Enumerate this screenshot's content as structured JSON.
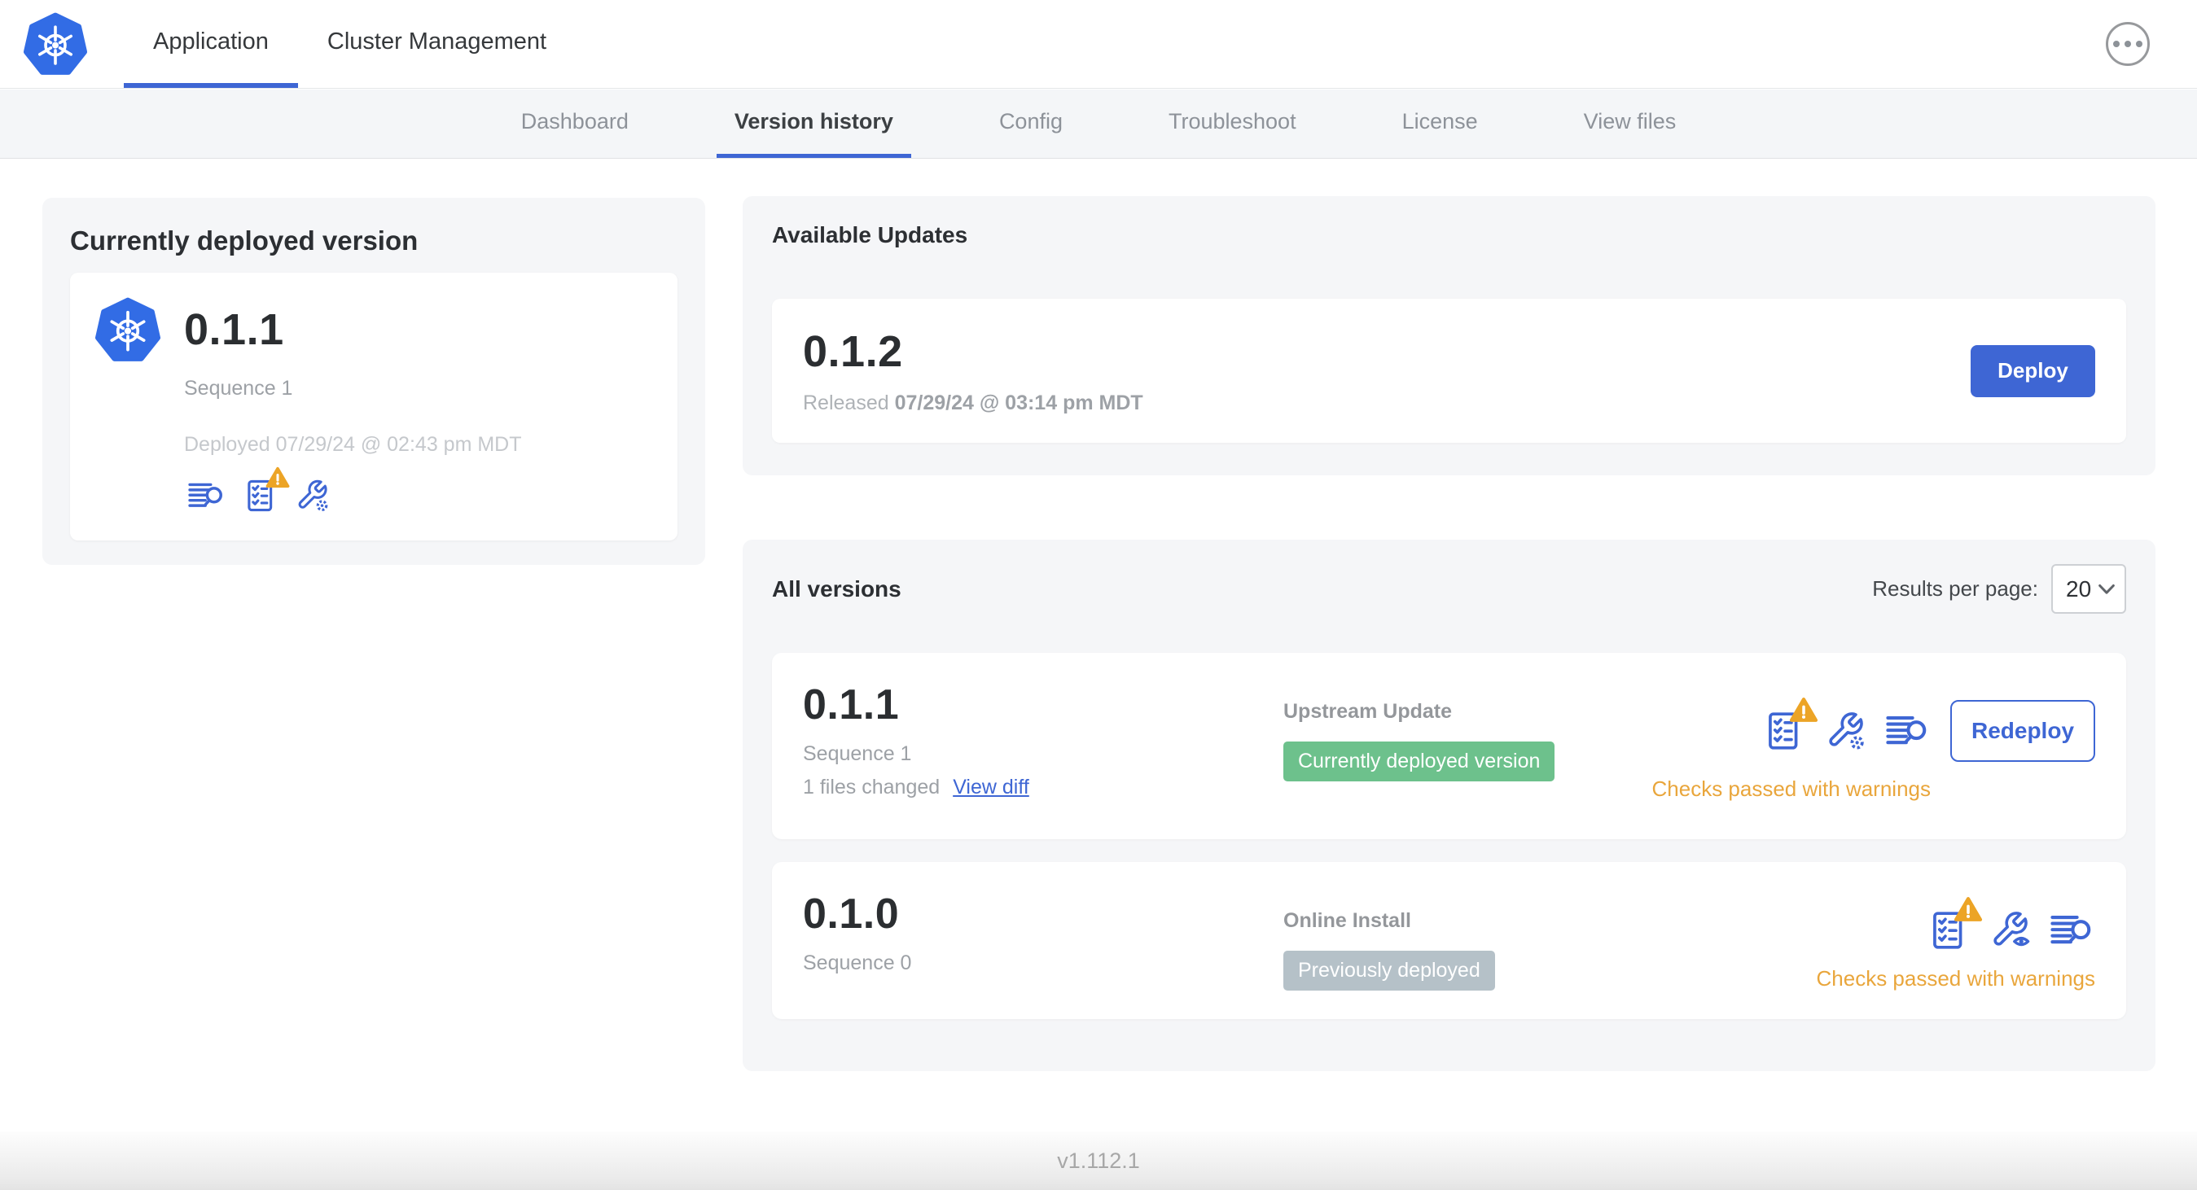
{
  "header": {
    "tabs": [
      {
        "label": "Application",
        "active": true
      },
      {
        "label": "Cluster Management",
        "active": false
      }
    ],
    "menu_icon": "ellipsis-icon"
  },
  "subnav": {
    "tabs": [
      {
        "label": "Dashboard",
        "active": false
      },
      {
        "label": "Version history",
        "active": true
      },
      {
        "label": "Config",
        "active": false
      },
      {
        "label": "Troubleshoot",
        "active": false
      },
      {
        "label": "License",
        "active": false
      },
      {
        "label": "View files",
        "active": false
      }
    ]
  },
  "deployed": {
    "title": "Currently deployed version",
    "version": "0.1.1",
    "sequence": "Sequence 1",
    "deployed_text": "Deployed 07/29/24 @ 02:43 pm MDT",
    "icons": [
      "view-logs-icon",
      "preflight-checks-warning-icon",
      "edit-config-icon"
    ]
  },
  "updates": {
    "title": "Available Updates",
    "version": "0.1.2",
    "released_label": "Released",
    "released_date": "07/29/24 @ 03:14 pm MDT",
    "deploy_label": "Deploy"
  },
  "all_versions": {
    "title": "All versions",
    "results_label": "Results per page:",
    "results_value": "20",
    "rows": [
      {
        "version": "0.1.1",
        "sequence": "Sequence 1",
        "files_changed": "1 files changed",
        "view_diff": "View diff",
        "source": "Upstream Update",
        "badge": "Currently deployed version",
        "badge_color": "#6dc18c",
        "status": "Checks passed with warnings",
        "action": "Redeploy",
        "icons": [
          "preflight-checks-warning-icon",
          "edit-config-icon",
          "view-logs-icon"
        ]
      },
      {
        "version": "0.1.0",
        "sequence": "Sequence 0",
        "source": "Online Install",
        "badge": "Previously deployed",
        "badge_color": "#b5c1c8",
        "status": "Checks passed with warnings",
        "icons": [
          "preflight-checks-warning-icon",
          "view-config-icon",
          "view-logs-icon"
        ]
      }
    ]
  },
  "footer": {
    "app_version": "v1.112.1"
  },
  "colors": {
    "accent_blue": "#3e66d4",
    "k8s_blue": "#326ce5",
    "green_badge": "#6dc18c",
    "gray_badge": "#b5c1c8",
    "warning_amber": "#e9a63c",
    "panel_bg": "#f5f6f8"
  }
}
